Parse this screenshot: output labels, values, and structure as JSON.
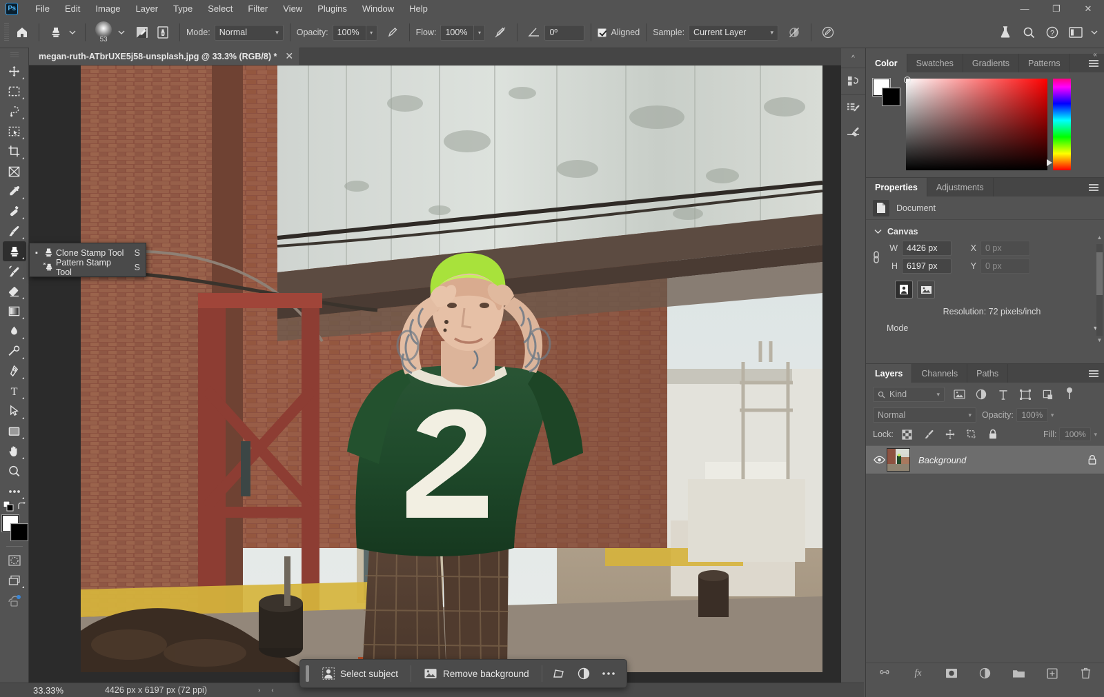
{
  "app": {
    "logo_text": "Ps",
    "menus": [
      "File",
      "Edit",
      "Image",
      "Layer",
      "Type",
      "Select",
      "Filter",
      "View",
      "Plugins",
      "Window",
      "Help"
    ],
    "window_controls": {
      "minimize": "—",
      "restore": "❐",
      "close": "✕"
    }
  },
  "options_bar": {
    "home_icon": "home-icon",
    "tool_icon": "clone-stamp-icon",
    "brush_size": "53",
    "toggle_brush_panel": "brush-settings-icon",
    "toggle_clone_source": "clone-source-icon",
    "mode_label": "Mode:",
    "mode_value": "Normal",
    "opacity_label": "Opacity:",
    "opacity_value": "100%",
    "opacity_pressure_icon": "pressure-opacity-icon",
    "flow_label": "Flow:",
    "flow_value": "100%",
    "airbrush_icon": "airbrush-icon",
    "angle_icon": "angle-icon",
    "angle_value": "0º",
    "aligned_label": "Aligned",
    "aligned_checked": true,
    "sample_label": "Sample:",
    "sample_value": "Current Layer",
    "ignore_adjust_icon": "ignore-adjustment-layers-icon",
    "pressure_size_icon": "pressure-size-icon",
    "right_icons": [
      "flask-icon",
      "search-icon",
      "help-icon",
      "workspace-icon",
      "chevron-down-icon"
    ]
  },
  "toolbar": {
    "tools": [
      {
        "name": "move-tool",
        "icon": "move"
      },
      {
        "name": "rectangular-marquee-tool",
        "icon": "marquee"
      },
      {
        "name": "lasso-tool",
        "icon": "lasso"
      },
      {
        "name": "object-selection-tool",
        "icon": "objectselect"
      },
      {
        "name": "crop-tool",
        "icon": "crop"
      },
      {
        "name": "frame-tool",
        "icon": "frame"
      },
      {
        "name": "eyedropper-tool",
        "icon": "eyedropper"
      },
      {
        "name": "spot-healing-brush-tool",
        "icon": "healing"
      },
      {
        "name": "brush-tool",
        "icon": "brush"
      },
      {
        "name": "clone-stamp-tool",
        "icon": "stamp",
        "active": true
      },
      {
        "name": "history-brush-tool",
        "icon": "historybrush"
      },
      {
        "name": "eraser-tool",
        "icon": "eraser"
      },
      {
        "name": "gradient-tool",
        "icon": "gradient"
      },
      {
        "name": "blur-tool",
        "icon": "blur"
      },
      {
        "name": "dodge-tool",
        "icon": "dodge"
      },
      {
        "name": "pen-tool",
        "icon": "pen"
      },
      {
        "name": "type-tool",
        "icon": "type"
      },
      {
        "name": "path-selection-tool",
        "icon": "pathselect"
      },
      {
        "name": "rectangle-tool",
        "icon": "rectangle"
      },
      {
        "name": "hand-tool",
        "icon": "hand"
      },
      {
        "name": "zoom-tool",
        "icon": "zoom"
      },
      {
        "name": "edit-toolbar-tool",
        "icon": "more"
      }
    ],
    "foreground_color": "#ffffff",
    "background_color": "#000000",
    "quick_mask_name": "quick-mask-mode",
    "screen_mode_name": "screen-mode",
    "cloud_name": "cloud-documents"
  },
  "tool_flyout": {
    "items": [
      {
        "label": "Clone Stamp Tool",
        "shortcut": "S",
        "selected": true,
        "icon": "clone-stamp-icon"
      },
      {
        "label": "Pattern Stamp Tool",
        "shortcut": "S",
        "selected": false,
        "icon": "pattern-stamp-icon"
      }
    ]
  },
  "document": {
    "tab_title": "megan-ruth-ATbrUXE5j58-unsplash.jpg @ 33.3% (RGB/8) *",
    "close_glyph": "✕"
  },
  "contextual_task_bar": {
    "select_subject": "Select subject",
    "select_subject_icon": "select-subject-icon",
    "remove_background": "Remove background",
    "remove_background_icon": "remove-background-icon",
    "transform_icon": "transform-icon",
    "adjustment_icon": "adjustment-layer-icon",
    "more_icon": "more-options-icon"
  },
  "status_bar": {
    "zoom": "33.33%",
    "dimensions": "4426 px x 6197 px (72 ppi)",
    "arrow_right": "›",
    "arrow_left": "‹"
  },
  "icon_dock": {
    "collapse_glyph": "«",
    "groups": [
      [
        "history-icon",
        "actions-icon"
      ],
      [
        "layer-comps-icon",
        "brushes-icon",
        "brush-settings-icon"
      ]
    ]
  },
  "color_panel": {
    "tabs": [
      {
        "label": "Color",
        "active": true
      },
      {
        "label": "Swatches",
        "active": false
      },
      {
        "label": "Gradients",
        "active": false
      },
      {
        "label": "Patterns",
        "active": false
      }
    ],
    "foreground": "#ffffff",
    "background": "#000000",
    "hue": "#ff0000",
    "menu_icon": "panel-menu-icon"
  },
  "properties_panel": {
    "tabs": [
      {
        "label": "Properties",
        "active": true
      },
      {
        "label": "Adjustments",
        "active": false
      }
    ],
    "menu_icon": "panel-menu-icon",
    "doc_row_label": "Document",
    "doc_row_icon": "document-icon",
    "section_title": "Canvas",
    "link_icon": "link-icon",
    "w_label": "W",
    "w_value": "4426 px",
    "h_label": "H",
    "h_value": "6197 px",
    "x_label": "X",
    "x_value": "0 px",
    "y_label": "Y",
    "y_value": "0 px",
    "portrait_icon": "portrait-orientation-icon",
    "landscape_icon": "landscape-orientation-icon",
    "resolution": "Resolution: 72 pixels/inch",
    "mode_label": "Mode"
  },
  "layers_panel": {
    "tabs": [
      {
        "label": "Layers",
        "active": true
      },
      {
        "label": "Channels",
        "active": false
      },
      {
        "label": "Paths",
        "active": false
      }
    ],
    "menu_icon": "panel-menu-icon",
    "filter_kind": "Kind",
    "filter_icons": [
      "filter-pixel-icon",
      "filter-adjustment-icon",
      "filter-type-icon",
      "filter-shape-icon",
      "filter-smart-object-icon"
    ],
    "filter_toggle": "filter-toggle-icon",
    "blend_mode": "Normal",
    "opacity_label": "Opacity:",
    "opacity_value": "100%",
    "lock_label": "Lock:",
    "lock_icons": [
      "lock-transparency-icon",
      "lock-image-icon",
      "lock-position-icon",
      "lock-artboard-icon",
      "lock-all-icon"
    ],
    "fill_label": "Fill:",
    "fill_value": "100%",
    "layers": [
      {
        "name": "Background",
        "visible": true,
        "locked": true,
        "eye_icon": "eye-icon",
        "lock_icon": "lock-icon"
      }
    ],
    "footer_icons": [
      "link-layers-icon",
      "layer-style-icon",
      "layer-mask-icon",
      "new-fill-adjustment-icon",
      "new-group-icon",
      "new-layer-icon",
      "delete-layer-icon"
    ],
    "footer_fx_label": "fx"
  }
}
